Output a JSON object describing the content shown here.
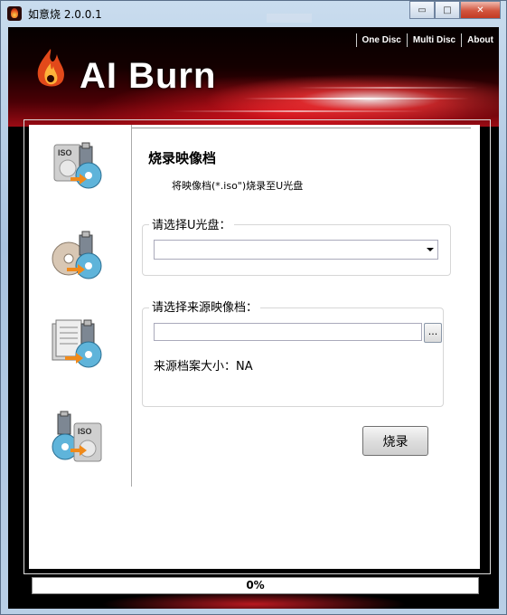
{
  "window": {
    "title": "如意烧 2.0.0.1",
    "buttons": {
      "minimize": "▭",
      "maximize": "□",
      "close": "✕"
    }
  },
  "header": {
    "logo_text": "AI Burn",
    "nav": [
      {
        "label": "One Disc"
      },
      {
        "label": "Multi Disc"
      },
      {
        "label": "About"
      }
    ]
  },
  "sidebar": {
    "items": [
      {
        "icon": "iso-to-usb-icon"
      },
      {
        "icon": "disc-to-usb-icon"
      },
      {
        "icon": "files-to-usb-icon"
      },
      {
        "icon": "usb-to-iso-icon"
      }
    ]
  },
  "main": {
    "title": "烧录映像档",
    "subtitle": "将映像档(*.iso\")烧录至U光盘",
    "usb_group_label": "请选择U光盘：",
    "usb_selected": "",
    "source_group_label": "请选择来源映像档：",
    "source_path": "",
    "browse_label": "...",
    "size_label": "来源档案大小：NA",
    "burn_button": "烧录"
  },
  "status": {
    "progress_text": "0%",
    "progress_fraction": 0
  },
  "colors": {
    "banner_dark": "#140000",
    "banner_red": "#9b0b14",
    "accent": "#d2553e"
  }
}
